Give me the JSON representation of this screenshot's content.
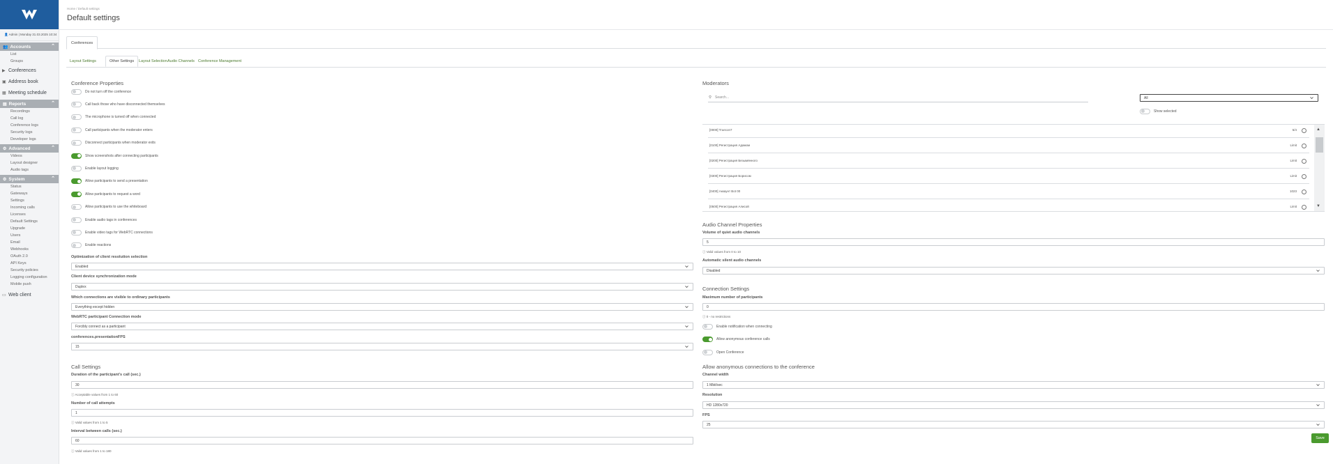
{
  "sidebar": {
    "user_line": "Admin | Monday 31.03.2025 10:34",
    "sections": {
      "accounts": {
        "label": "Accounts",
        "items": [
          "List",
          "Groups"
        ]
      },
      "reports": {
        "label": "Reports",
        "items": [
          "Recordings",
          "Call log",
          "Conference logs",
          "Security logs",
          "Developer logs"
        ]
      },
      "advanced": {
        "label": "Advanced",
        "items": [
          "Videos",
          "Layout designer",
          "Audio tags"
        ]
      },
      "system": {
        "label": "System",
        "items": [
          "Status",
          "Gateways",
          "Settings",
          "Incoming calls",
          "Licenses",
          "Default Settings",
          "Upgrade",
          "Users",
          "Email",
          "Webhooks",
          "OAuth 2.0",
          "API Keys",
          "Security policies",
          "Logging configuration",
          "Mobile push"
        ]
      }
    },
    "top_items": {
      "conferences": "Conferences",
      "address_book": "Address book",
      "meeting_schedule": "Meeting schedule",
      "web_client": "Web client"
    }
  },
  "header": {
    "breadcrumb": "Home / Default settings",
    "title": "Default settings"
  },
  "outer_tab": "Conferences",
  "inner_tabs": [
    "Layout Settings",
    "Other Settings",
    "Layout Selection",
    "Audio Channels",
    "Conference Management"
  ],
  "conference_properties": {
    "title": "Conference Properties",
    "toggles": [
      {
        "label": "Do not turn off the conference",
        "on": false
      },
      {
        "label": "Call back those who have disconnected themselves",
        "on": false
      },
      {
        "label": "The microphone is turned off when connected",
        "on": false
      },
      {
        "label": "Call participants when the moderator enters",
        "on": false
      },
      {
        "label": "Disconnect participants when moderator exits",
        "on": false
      },
      {
        "label": "Show screenshots after connecting participants",
        "on": true
      },
      {
        "label": "Enable layout logging",
        "on": false
      },
      {
        "label": "Allow participants to send a presentation",
        "on": true
      },
      {
        "label": "Allow participants to request a word",
        "on": true
      },
      {
        "label": "Allow participants to use the whiteboard",
        "on": false
      },
      {
        "label": "Enable audio tags in conferences",
        "on": false
      },
      {
        "label": "Enable video tags for WebRTC connections",
        "on": false
      },
      {
        "label": "Enable reactions",
        "on": false
      }
    ],
    "selects": [
      {
        "label": "Optimization of client resolution selection",
        "value": "Enabled"
      },
      {
        "label": "Client device synchronization mode",
        "value": "Duplex"
      },
      {
        "label": "Which connections are visible to ordinary participants",
        "value": "Everything except hidden"
      },
      {
        "label": "WebRTC participant Connection mode",
        "value": "Forcibly connect as a participant"
      },
      {
        "label": "conferences.presentationFPS",
        "value": "15"
      }
    ]
  },
  "call_settings": {
    "title": "Call Settings",
    "fields": [
      {
        "label": "Duration of the participant's call (sec.)",
        "value": "30",
        "hint": "Acceptable values from 1 to 60"
      },
      {
        "label": "Number of call attempts",
        "value": "1",
        "hint": "Valid values from 1 to 5"
      },
      {
        "label": "Interval between calls (sec.)",
        "value": "60",
        "hint": "Valid values from 1 to 180"
      }
    ]
  },
  "moderators": {
    "title": "Moderators",
    "search_placeholder": "Search...",
    "filter_value": "All",
    "show_selected_label": "Show selected",
    "rows": [
      {
        "name": "[0000] Truecon7",
        "count": "5/4"
      },
      {
        "name": "[0100] Регистрация Адамом",
        "count": "Limit"
      },
      {
        "name": "[0200] Регистрация Безымянного",
        "count": "Limit"
      },
      {
        "name": "[0300] Регистрация Борисом",
        "count": "Limit"
      },
      {
        "name": "[0400] Аккаунт Bot 00",
        "count": "1023"
      },
      {
        "name": "[0500] Регистрация Алисой",
        "count": "Limit"
      }
    ]
  },
  "audio_channel": {
    "title": "Audio Channel Properties",
    "fields": {
      "volume_label": "Volume of quiet audio channels",
      "volume_value": "5",
      "volume_hint": "Valid values from 0 to 10",
      "auto_silent_label": "Automatic silent audio channels",
      "auto_silent_value": "Disabled"
    }
  },
  "connection_settings": {
    "title": "Connection Settings",
    "max_label": "Maximum number of participants",
    "max_value": "0",
    "max_hint": "0 - no restrictions",
    "toggles": [
      {
        "label": "Enable notification when connecting",
        "on": false
      },
      {
        "label": "Allow anonymous conference calls",
        "on": true
      },
      {
        "label": "Open Conference",
        "on": false
      }
    ]
  },
  "anonymous": {
    "title": "Allow anonymous connections to the conference",
    "selects": [
      {
        "label": "Channel width",
        "value": "1 Mbit/sec"
      },
      {
        "label": "Resolution",
        "value": "HD 1280x720"
      },
      {
        "label": "FPS",
        "value": "25"
      }
    ]
  },
  "save_label": "Save",
  "colors": {
    "brand": "#1f5d9e",
    "accent": "#4a9a2e",
    "sidebar_header": "#a9aeb3"
  }
}
